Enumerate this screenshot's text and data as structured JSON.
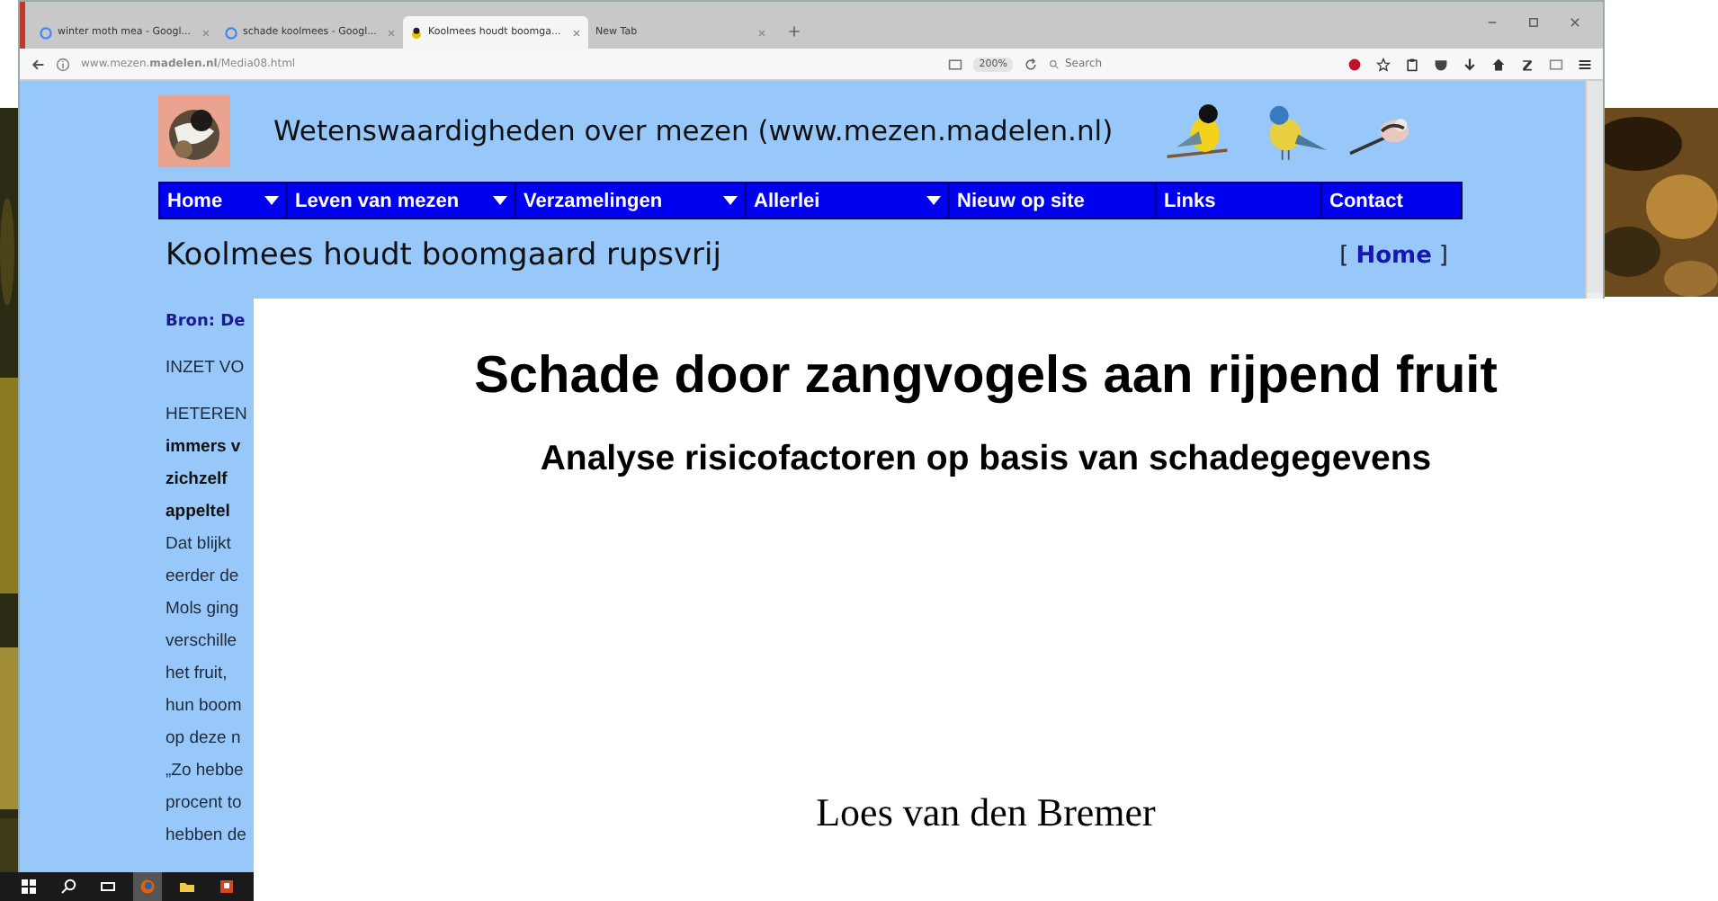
{
  "browser": {
    "tabs": [
      {
        "label": "winter moth mea - Googl...",
        "kind": "google",
        "selected": false
      },
      {
        "label": "schade koolmees - Googl...",
        "kind": "google",
        "selected": false
      },
      {
        "label": "Koolmees houdt boomga...",
        "kind": "site",
        "selected": true
      },
      {
        "label": "New Tab",
        "kind": "blank",
        "selected": false
      }
    ],
    "url": "www.mezen.**madelen.nl**/Media08.html",
    "zoom": "200%",
    "search": {
      "placeholder": "Search"
    }
  },
  "site": {
    "title": "Wetenswaardigheden over mezen (www.mezen.madelen.nl)",
    "menu": [
      {
        "label": "Home",
        "has_submenu": true
      },
      {
        "label": "Leven van mezen",
        "has_submenu": true
      },
      {
        "label": "Verzamelingen",
        "has_submenu": true
      },
      {
        "label": "Allerlei",
        "has_submenu": true
      },
      {
        "label": "Nieuw op site",
        "has_submenu": false
      },
      {
        "label": "Links",
        "has_submenu": false
      },
      {
        "label": "Contact",
        "has_submenu": false
      }
    ],
    "heading": "Koolmees houdt boomgaard rupsvrij",
    "home_link": "Home",
    "bracket_open": "[",
    "bracket_close": "]",
    "source": "Bron: De",
    "paragraphs": [
      {
        "lines": [
          {
            "text": "INZET VO",
            "bold": false
          }
        ]
      },
      {
        "lines": [
          {
            "text": "HETEREN",
            "bold": false
          },
          {
            "text": "immers v",
            "bold": true
          },
          {
            "text": "zichzelf",
            "bold": true
          },
          {
            "text": "appeltel",
            "bold": true
          },
          {
            "text": "Dat blijkt",
            "bold": false
          },
          {
            "text": "eerder de",
            "bold": false
          },
          {
            "text": "Mols ging",
            "bold": false
          },
          {
            "text": "verschille",
            "bold": false
          },
          {
            "text": "het fruit,",
            "bold": false
          },
          {
            "text": "hun boom",
            "bold": false
          },
          {
            "text": "op deze n",
            "bold": false
          },
          {
            "text": "„Zo hebbe",
            "bold": false
          },
          {
            "text": "procent to",
            "bold": false
          },
          {
            "text": "hebben de",
            "bold": false
          }
        ]
      }
    ]
  },
  "document": {
    "title": "Schade door zangvogels aan rijpend fruit",
    "subtitle": "Analyse risicofactoren op basis van schadegegevens",
    "author": "Loes van den Bremer"
  },
  "taskbar": [
    {
      "kind": "start"
    },
    {
      "kind": "search"
    },
    {
      "kind": "taskview"
    },
    {
      "kind": "firefox",
      "selected": true
    },
    {
      "kind": "folder",
      "selected": false
    },
    {
      "kind": "powerpoint",
      "selected": false
    }
  ]
}
